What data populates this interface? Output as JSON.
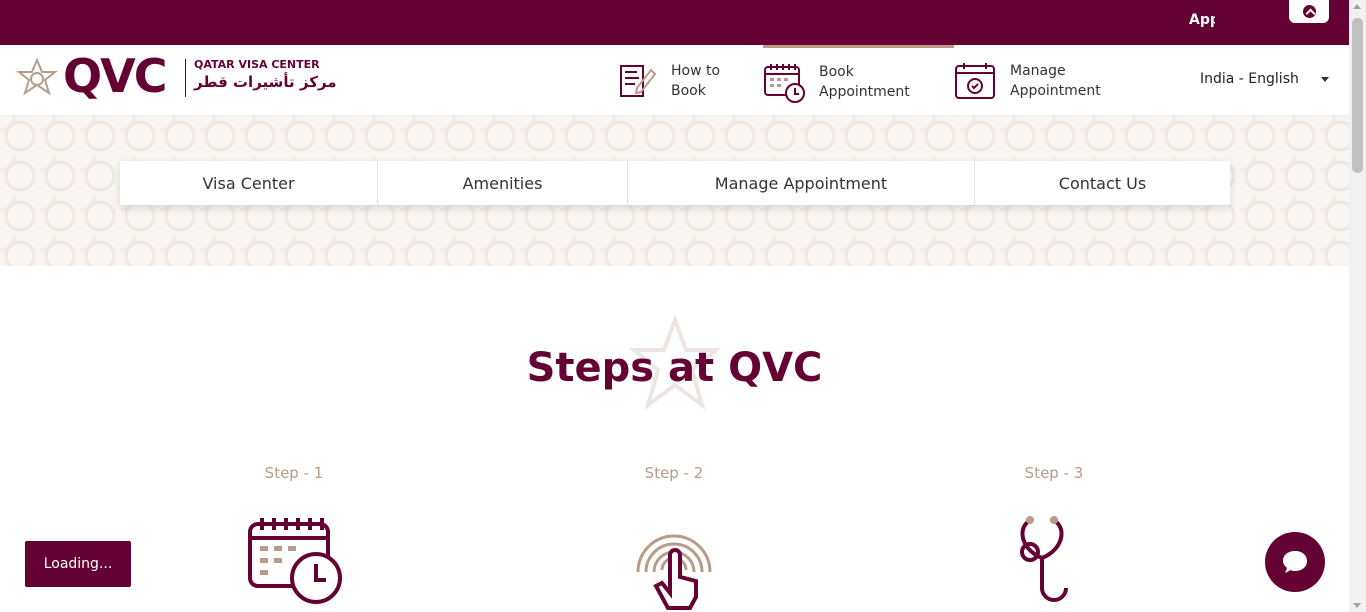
{
  "topbar": {
    "app_text": "App",
    "scroll_top_icon": "chevron-up-icon"
  },
  "header": {
    "logo_text": "QVC",
    "logo_en": "QATAR VISA CENTER",
    "logo_ar": "مركز تأشيرات قطر",
    "nav": [
      {
        "label": "How to Book",
        "icon": "form-pen-icon"
      },
      {
        "label": "Book Appointment",
        "icon": "calendar-clock-icon"
      },
      {
        "label": "Manage Appointment",
        "icon": "calendar-check-icon"
      }
    ],
    "language": "India - English"
  },
  "subnav": [
    "Visa Center",
    "Amenities",
    "Manage Appointment",
    "Contact Us"
  ],
  "steps": {
    "title": "Steps at QVC",
    "items": [
      {
        "label": "Step - 1",
        "icon": "calendar-clock-icon"
      },
      {
        "label": "Step - 2",
        "icon": "fingerprint-touch-icon"
      },
      {
        "label": "Step - 3",
        "icon": "stethoscope-icon"
      }
    ]
  },
  "loading_text": "Loading...",
  "chat_icon": "chat-bubble-icon",
  "colors": {
    "brand": "#640333",
    "accent": "#b89b89"
  }
}
